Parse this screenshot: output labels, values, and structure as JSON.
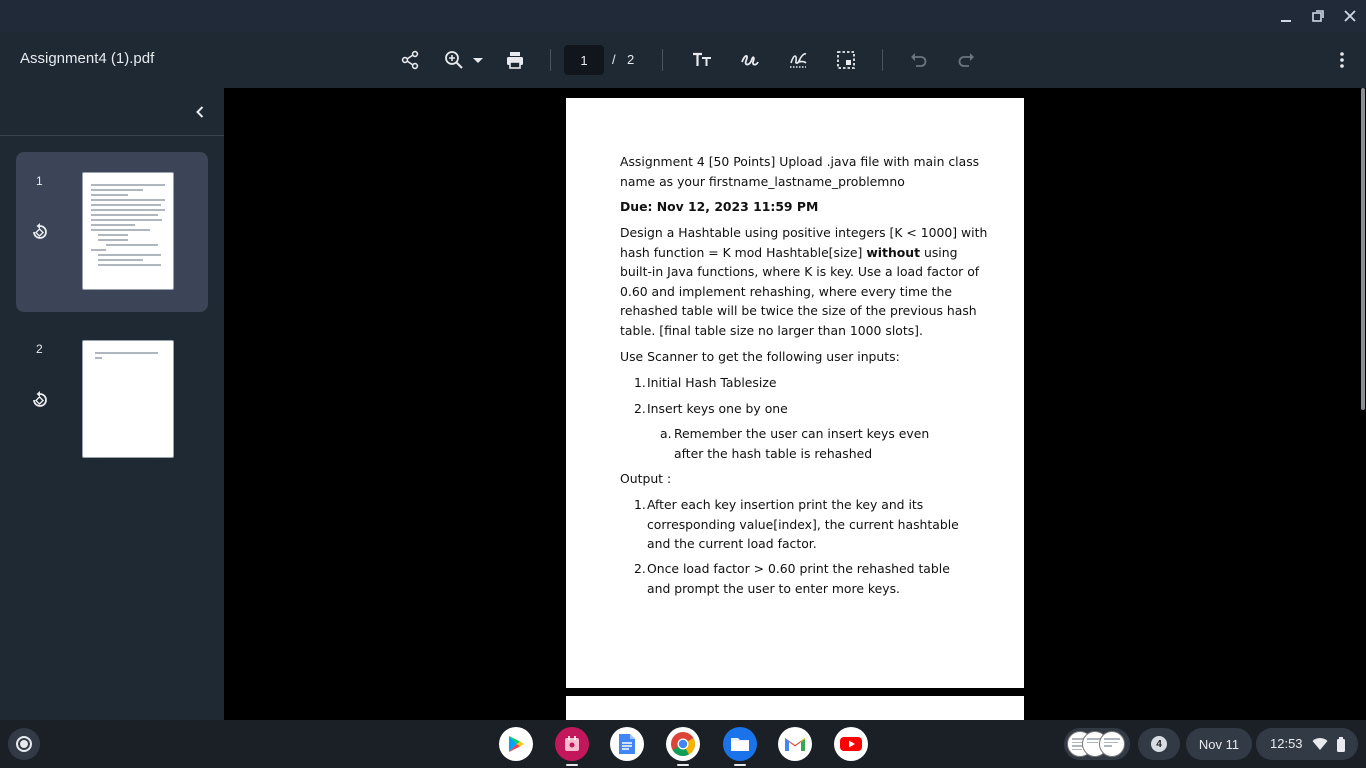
{
  "window": {
    "controls": [
      "minimize",
      "restore",
      "close"
    ]
  },
  "toolbar": {
    "title": "Assignment4 (1).pdf",
    "current_page": "1",
    "page_separator": "/",
    "total_pages": "2"
  },
  "sidebar": {
    "thumbnails": [
      {
        "number": "1",
        "active": true
      },
      {
        "number": "2",
        "active": false
      }
    ]
  },
  "document": {
    "header_line1": "Assignment 4 [50 Points] Upload .java file with main class",
    "header_line2": "name as your firstname_lastname_problemno",
    "due": "Due: Nov 12, 2023 11:59 PM",
    "p1_before_bold": "Design a Hashtable using positive integers [K < 1000] with hash function = K mod Hashtable[size] ",
    "p1_bold": "without",
    "p1_after_bold": " using built-in Java functions, where K is key. Use a load factor of 0.60 and implement rehashing, where every time the rehashed table will be twice the size of the previous hash table. [final table size no larger than 1000 slots].",
    "inputs_heading": "Use Scanner to get the following user inputs:",
    "inputs": [
      {
        "marker": "1.",
        "text": "Initial Hash Tablesize"
      },
      {
        "marker": "2.",
        "text": "Insert keys one by one"
      }
    ],
    "sub_input": {
      "marker": "a.",
      "text": "Remember the user can insert keys even after the hash table is rehashed"
    },
    "output_heading": "Output :",
    "outputs": [
      {
        "marker": "1.",
        "text": "After each key insertion print the key and its corresponding value[index], the current hashtable and the current load factor."
      },
      {
        "marker": "2.",
        "text": "Once load factor > 0.60 print the rehashed table and prompt the user to enter more keys."
      }
    ]
  },
  "shelf": {
    "apps": [
      "play-store",
      "canvas",
      "docs",
      "chrome",
      "files",
      "gmail",
      "youtube"
    ],
    "notification_count": "4",
    "date": "Nov 11",
    "time": "12:53"
  },
  "colors": {
    "titlebar": "#202a38",
    "toolbar": "#1f2933",
    "active_thumb": "#3b4557",
    "viewer_bg": "#000000",
    "shelf": "#1b2027"
  }
}
